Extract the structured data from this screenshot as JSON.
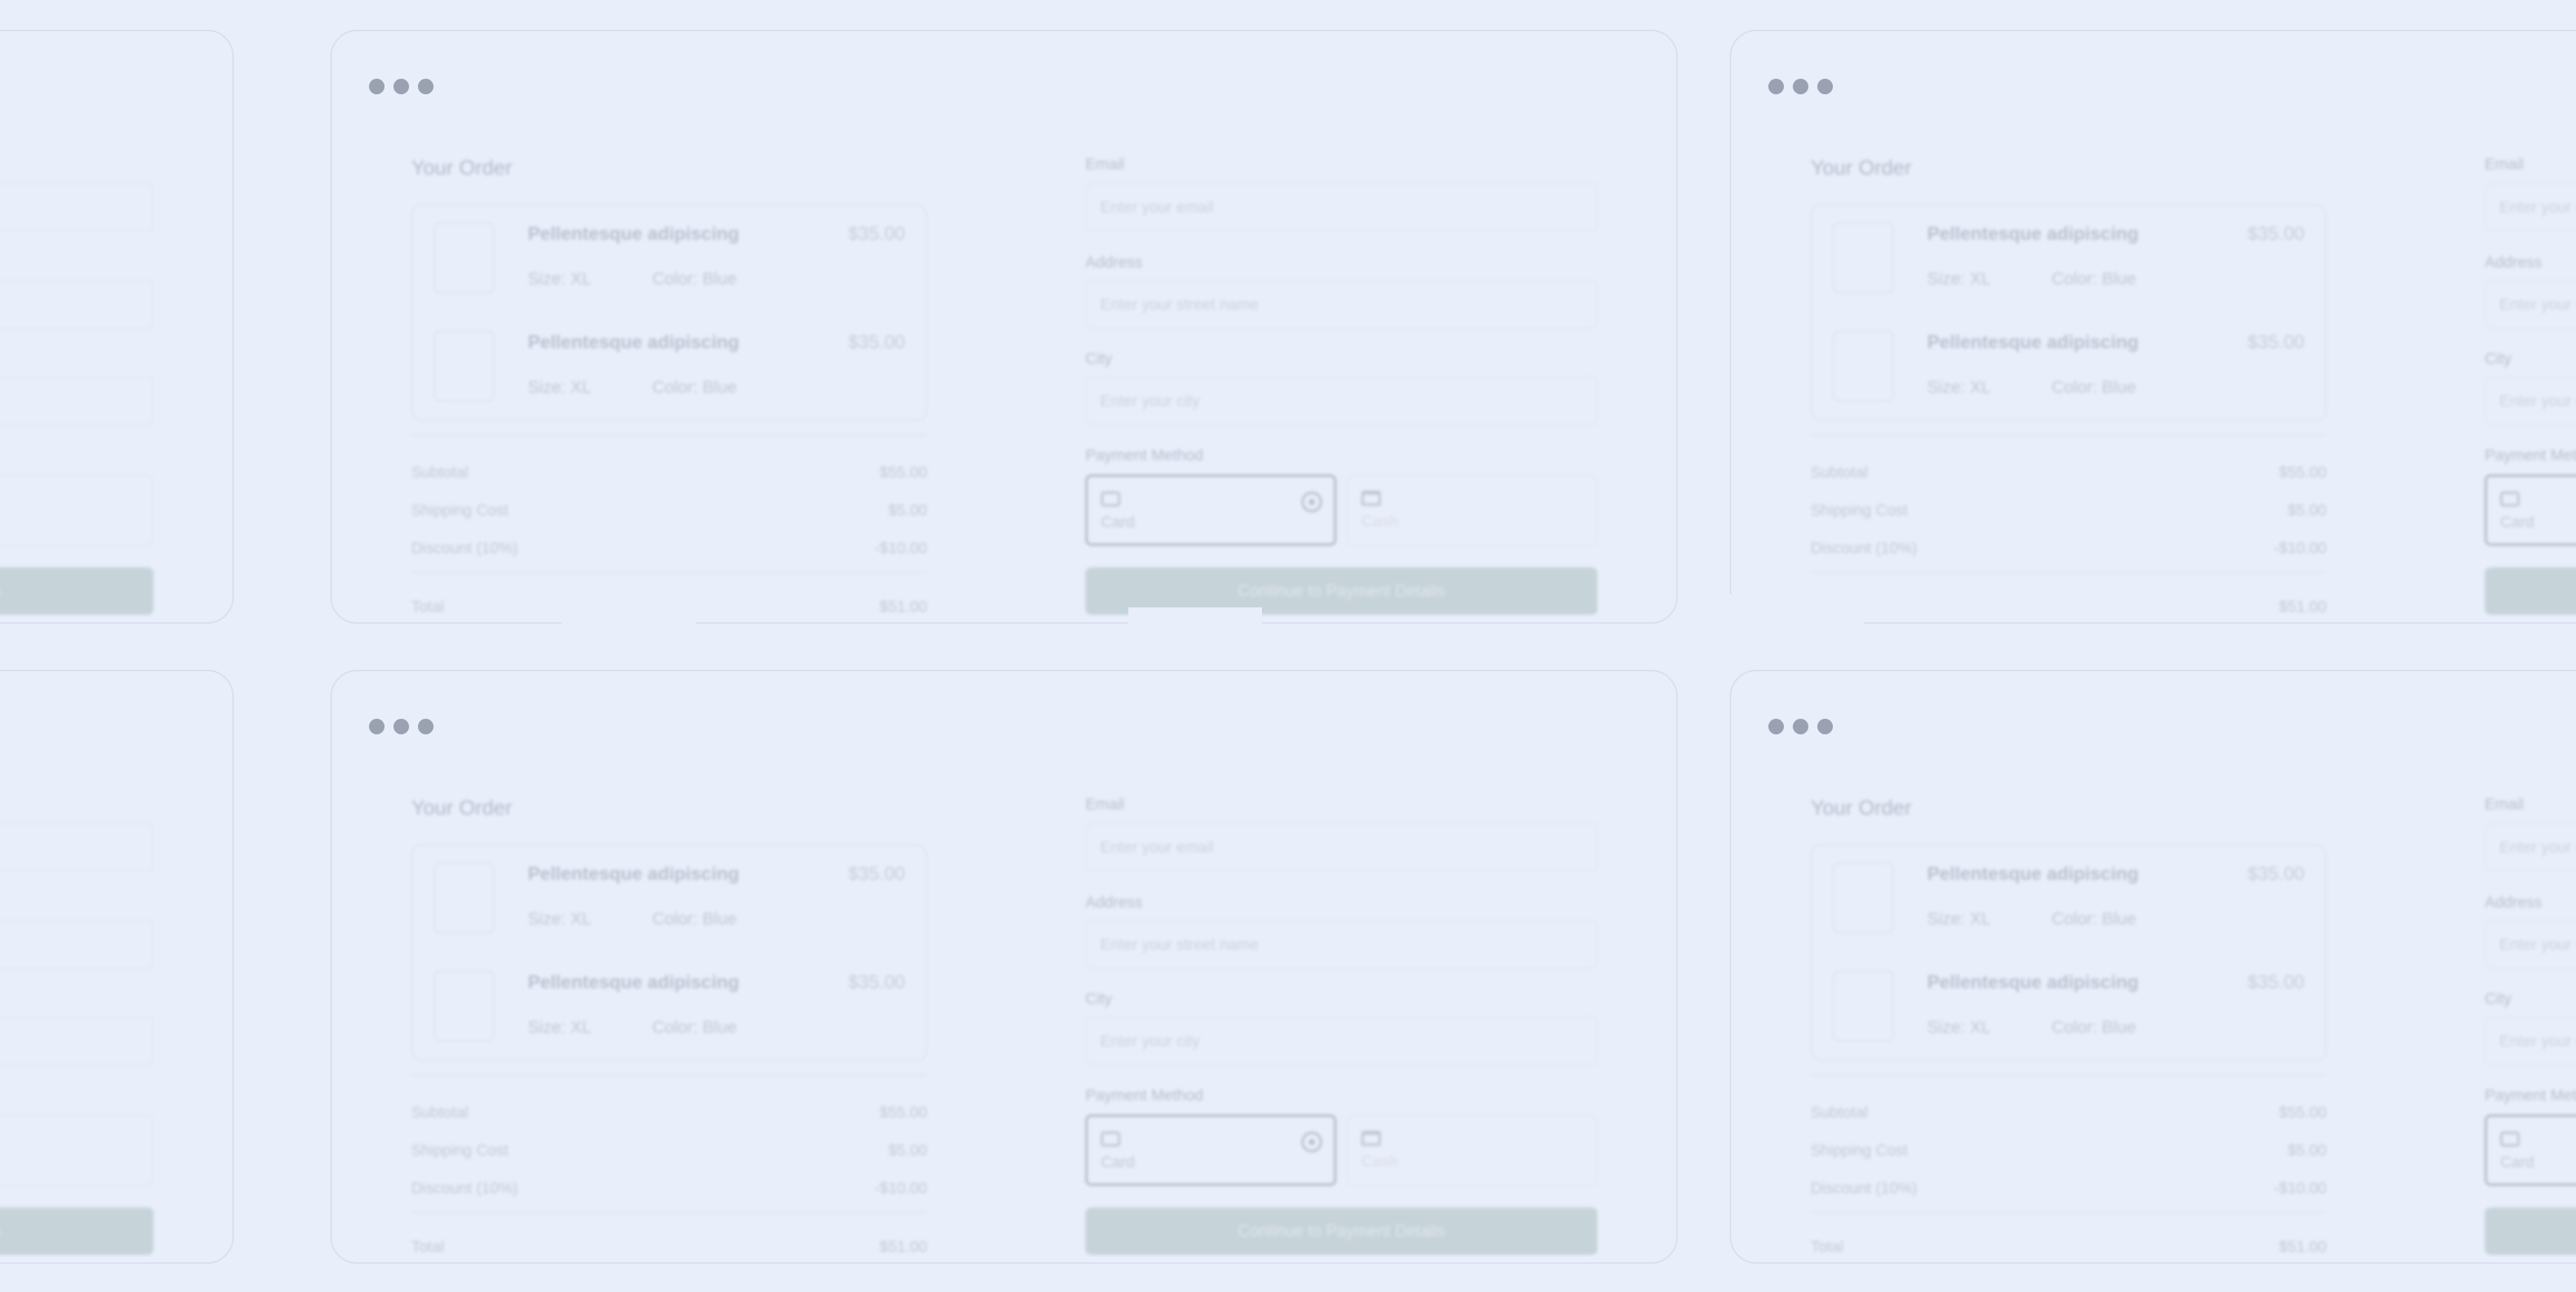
{
  "order": {
    "title": "Your Order",
    "items": [
      {
        "name": "Pellentesque adipiscing",
        "price": "$35.00",
        "size_label": "Size:",
        "size": "XL",
        "color_label": "Color:",
        "color": "Blue"
      },
      {
        "name": "Pellentesque adipiscing",
        "price": "$35.00",
        "size_label": "Size:",
        "size": "XL",
        "color_label": "Color:",
        "color": "Blue"
      }
    ],
    "subtotal_label": "Subtotal",
    "subtotal": "$55.00",
    "shipping_label": "Shipping Cost",
    "shipping": "$5.00",
    "discount_label": "Discount (10%)",
    "discount": "-$10.00",
    "total_label": "Total",
    "total": "$51.00"
  },
  "form": {
    "email_label": "Email",
    "email_placeholder": "Enter your email",
    "address_label": "Address",
    "address_placeholder": "Enter your street name",
    "city_label": "City",
    "city_placeholder": "Enter your city",
    "payment_label": "Payment Method",
    "payment_options": [
      "Card",
      "Cash"
    ],
    "continue_label": "Continue to Payment Details"
  },
  "colors": {
    "background": "#e9eefb",
    "button": "#c1cfd4",
    "window_dots": "#9aa1b1"
  },
  "icons": [
    "window-dot-icon",
    "card-icon",
    "bank-icon",
    "radio-selected-icon"
  ]
}
